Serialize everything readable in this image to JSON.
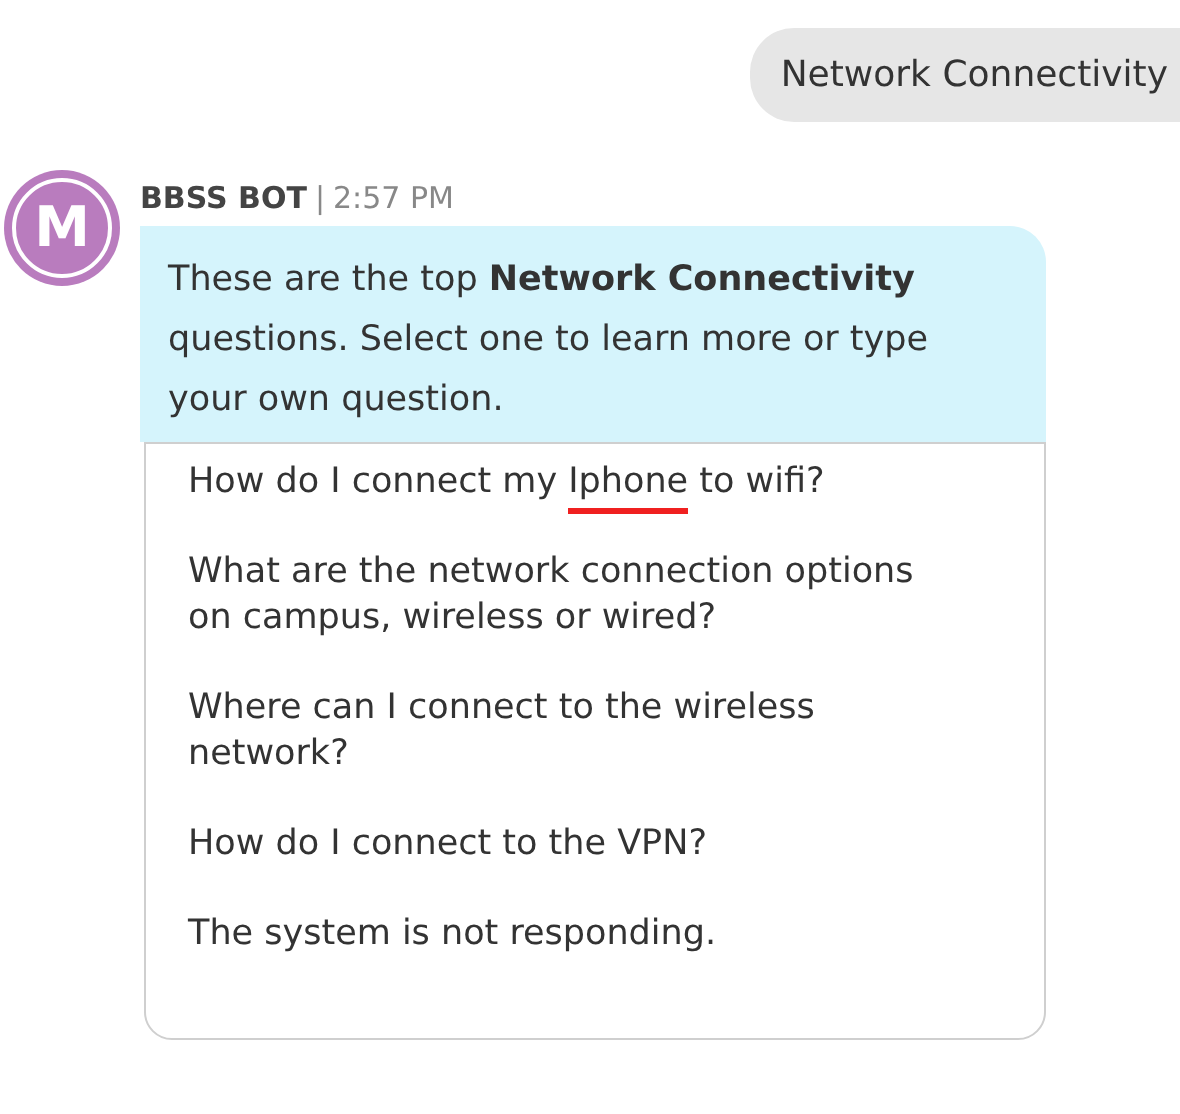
{
  "user_message": {
    "text": "Network Connectivity"
  },
  "bot_message": {
    "avatar_letter": "M",
    "sender": "BBSS BOT",
    "separator": "|",
    "time": "2:57 PM",
    "text": "These are the top **Network Connectivity** questions. Select one to learn more or type your own question."
  },
  "questions": [
    {
      "parts": [
        {
          "text": "How do I connect my ",
          "spelling_error": false
        },
        {
          "text": "Iphone",
          "spelling_error": true
        },
        {
          "text": " to wifi?",
          "spelling_error": false
        }
      ]
    },
    {
      "text": "What are the network connection options on campus, wireless or wired?"
    },
    {
      "text": "Where can I connect to the wireless network?"
    },
    {
      "text": "How do I connect to the VPN?"
    },
    {
      "text": "The system is not responding."
    }
  ]
}
